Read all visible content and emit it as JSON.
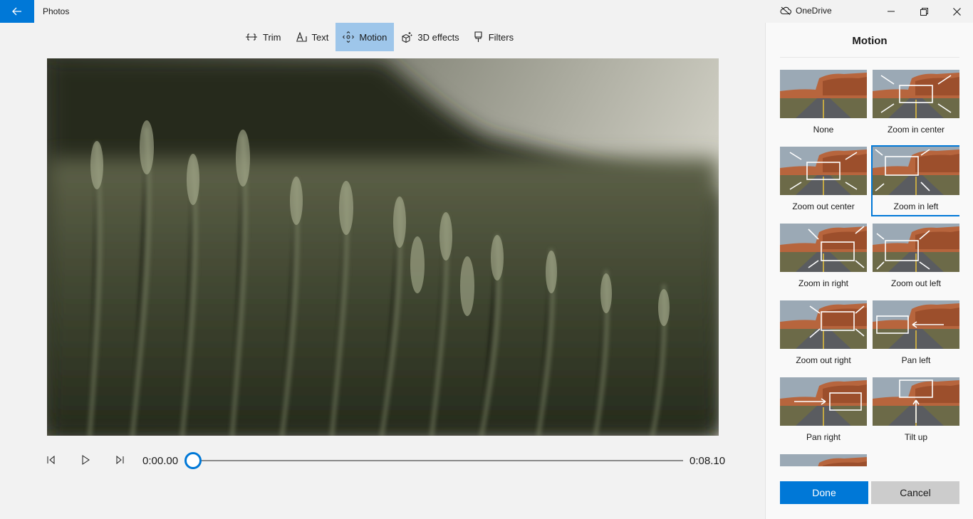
{
  "app": {
    "title": "Photos",
    "onedrive_label": "OneDrive"
  },
  "toolbar": {
    "items": [
      {
        "label": "Trim",
        "icon": "trim-icon",
        "active": false
      },
      {
        "label": "Text",
        "icon": "text-icon",
        "active": false
      },
      {
        "label": "Motion",
        "icon": "motion-icon",
        "active": true
      },
      {
        "label": "3D effects",
        "icon": "3d-effects-icon",
        "active": false
      },
      {
        "label": "Filters",
        "icon": "filters-icon",
        "active": false
      }
    ]
  },
  "player": {
    "current_time": "0:00.00",
    "total_time": "0:08.10",
    "progress": 0
  },
  "panel": {
    "title": "Motion",
    "options": [
      {
        "label": "None",
        "selected": false
      },
      {
        "label": "Zoom in center",
        "selected": false
      },
      {
        "label": "Zoom out center",
        "selected": false
      },
      {
        "label": "Zoom in left",
        "selected": true
      },
      {
        "label": "Zoom in right",
        "selected": false
      },
      {
        "label": "Zoom out left",
        "selected": false
      },
      {
        "label": "Zoom out right",
        "selected": false
      },
      {
        "label": "Pan left",
        "selected": false
      },
      {
        "label": "Pan right",
        "selected": false
      },
      {
        "label": "Tilt up",
        "selected": false
      }
    ],
    "done_label": "Done",
    "cancel_label": "Cancel"
  },
  "colors": {
    "accent": "#0078d7",
    "active_tool": "#9ec6ea"
  }
}
